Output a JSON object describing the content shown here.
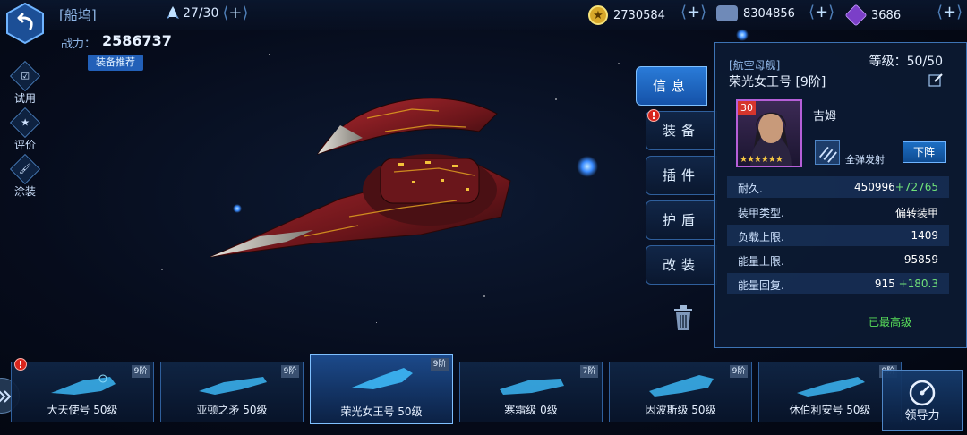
{
  "topbar": {
    "title": "[船坞]",
    "fleet_count": "27/30",
    "resources": [
      {
        "icon": "gold-coin-icon",
        "value": "2730584"
      },
      {
        "icon": "metal-ore-icon",
        "value": "8304856"
      },
      {
        "icon": "crystal-icon",
        "value": "3686"
      }
    ],
    "plus": "+"
  },
  "power": {
    "label": "战力：",
    "value": "2586737",
    "equip_recommend": "装备推荐"
  },
  "sidebar": [
    {
      "label": "试用",
      "icon": "trial-icon"
    },
    {
      "label": "评价",
      "icon": "rating-icon"
    },
    {
      "label": "涂装",
      "icon": "paint-icon"
    }
  ],
  "tabs": [
    {
      "label": "信息",
      "active": true,
      "alert": false
    },
    {
      "label": "装备",
      "active": false,
      "alert": true
    },
    {
      "label": "插件",
      "active": false,
      "alert": false
    },
    {
      "label": "护盾",
      "active": false,
      "alert": false
    },
    {
      "label": "改装",
      "active": false,
      "alert": false
    }
  ],
  "alert_mark": "!",
  "info": {
    "ship_class": "[航空母舰]",
    "level": "等级：50/50",
    "ship_name": "荣光女王号 [9阶]",
    "captain": {
      "level": "30",
      "name": "吉姆",
      "stars": "★★★★★★",
      "skill": "全弹发射",
      "unassign": "下阵"
    },
    "stats": [
      {
        "key": "耐久.",
        "value": "450996",
        "bonus": "+72765"
      },
      {
        "key": "装甲类型.",
        "value": "偏转装甲",
        "bonus": ""
      },
      {
        "key": "负载上限.",
        "value": "1409",
        "bonus": ""
      },
      {
        "key": "能量上限.",
        "value": "95859",
        "bonus": ""
      },
      {
        "key": "能量回复.",
        "value": "915",
        "bonus": "+180.3"
      }
    ],
    "max_grade": "已最高级"
  },
  "ships": [
    {
      "name": "大天使号 50级",
      "tier": "9阶",
      "alert": true,
      "active": false
    },
    {
      "name": "亚顿之矛 50级",
      "tier": "9阶",
      "alert": false,
      "active": false
    },
    {
      "name": "荣光女王号 50级",
      "tier": "9阶",
      "alert": false,
      "active": true
    },
    {
      "name": "寒霜级 0级",
      "tier": "7阶",
      "alert": false,
      "active": false
    },
    {
      "name": "因波斯级 50级",
      "tier": "9阶",
      "alert": false,
      "active": false
    },
    {
      "name": "休伯利安号 50级",
      "tier": "9阶",
      "alert": false,
      "active": false
    }
  ],
  "command": {
    "label": "领导力"
  },
  "colors": {
    "accent": "#2a7bd8",
    "bonus": "#6fe07a",
    "max_grade": "#59e05a",
    "alert": "#d8241c",
    "ship_hull": "#8a1f24"
  }
}
